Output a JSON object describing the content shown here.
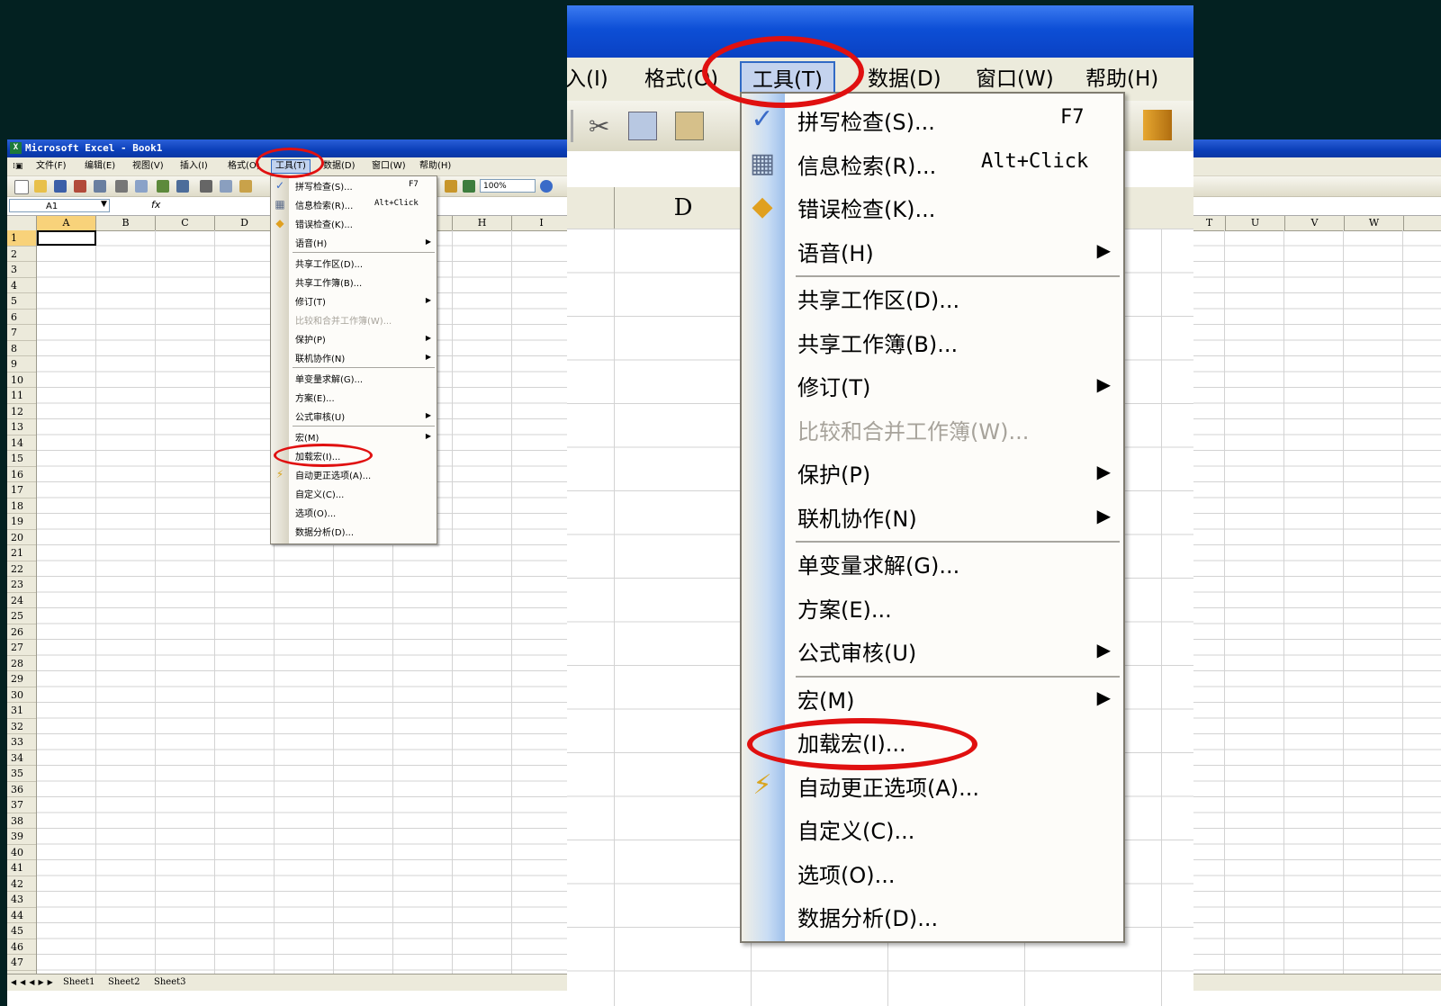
{
  "window": {
    "title": "Microsoft Excel - Book1",
    "app_icon": "excel-icon"
  },
  "menubar": [
    "文件(F)",
    "编辑(E)",
    "视图(V)",
    "插入(I)",
    "格式(O)",
    "工具(T)",
    "数据(D)",
    "窗口(W)",
    "帮助(H)"
  ],
  "toolbar": {
    "zoom": "100%"
  },
  "formula_bar": {
    "name_box": "A1",
    "fx": "fx"
  },
  "columns_left": [
    "A",
    "B",
    "C",
    "D",
    "H",
    "I",
    "T",
    "U",
    "V",
    "W"
  ],
  "rows": [
    "1",
    "2",
    "3",
    "4",
    "5",
    "6",
    "7",
    "8",
    "9",
    "10",
    "11",
    "12",
    "13",
    "14",
    "15",
    "16",
    "17",
    "18",
    "19",
    "20",
    "21",
    "22",
    "23",
    "24",
    "25",
    "26",
    "27",
    "28",
    "29",
    "30",
    "31",
    "32",
    "33",
    "34",
    "35",
    "36",
    "37",
    "38",
    "39",
    "40",
    "41",
    "42",
    "43",
    "44",
    "45",
    "46",
    "47"
  ],
  "sheets": [
    "Sheet1",
    "Sheet2",
    "Sheet3"
  ],
  "tools_menu": {
    "items": [
      {
        "label": "拼写检查(S)...",
        "shortcut": "F7",
        "icon": "spellcheck-icon"
      },
      {
        "label": "信息检索(R)...",
        "shortcut": "Alt+Click",
        "icon": "research-icon"
      },
      {
        "label": "错误检查(K)...",
        "icon": "error-check-icon"
      },
      {
        "label": "语音(H)",
        "submenu": true
      },
      {
        "label": "共享工作区(D)..."
      },
      {
        "label": "共享工作簿(B)..."
      },
      {
        "label": "修订(T)",
        "submenu": true
      },
      {
        "label": "比较和合并工作簿(W)...",
        "disabled": true
      },
      {
        "label": "保护(P)",
        "submenu": true
      },
      {
        "label": "联机协作(N)",
        "submenu": true
      },
      {
        "label": "单变量求解(G)..."
      },
      {
        "label": "方案(E)..."
      },
      {
        "label": "公式审核(U)",
        "submenu": true
      },
      {
        "label": "宏(M)",
        "submenu": true
      },
      {
        "label": "加载宏(I)...",
        "highlighted": true
      },
      {
        "label": "自动更正选项(A)...",
        "icon": "autocorrect-icon"
      },
      {
        "label": "自定义(C)..."
      },
      {
        "label": "选项(O)..."
      },
      {
        "label": "数据分析(D)..."
      }
    ],
    "arrow": "▶"
  },
  "zoom_panel": {
    "menubar": [
      "入(I)",
      "格式(O)",
      "工具(T)",
      "数据(D)",
      "窗口(W)",
      "帮助(H)"
    ],
    "column": "D"
  },
  "colors": {
    "annotation": "#e01010",
    "titlebar": "#0b3fb8",
    "menu_highlight": "#c1d2ee"
  }
}
